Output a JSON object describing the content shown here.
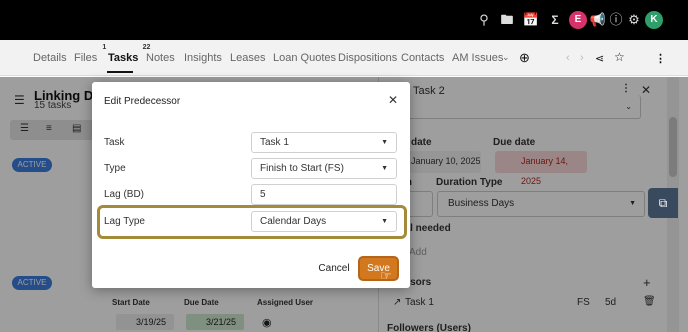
{
  "topbar": {
    "icons": [
      "search-icon",
      "folder-icon",
      "calendar-icon",
      "sigma-icon",
      "megaphone-icon",
      "help-icon",
      "gear-icon"
    ],
    "avatar_e": "E",
    "avatar_k": "K",
    "colors": {
      "avatar_e": "#d6336c",
      "avatar_k": "#2f9e6a"
    }
  },
  "tabs": [
    {
      "label": "Details"
    },
    {
      "label": "Files",
      "badge": "1"
    },
    {
      "label": "Tasks",
      "badge": "22",
      "active": true
    },
    {
      "label": "Notes"
    },
    {
      "label": "Insights"
    },
    {
      "label": "Leases"
    },
    {
      "label": "Loan Quotes"
    },
    {
      "label": "Dispositions"
    },
    {
      "label": "Contacts"
    },
    {
      "label": "AM Issues"
    }
  ],
  "left": {
    "title": "Linking Dea",
    "subtitle": "15 tasks",
    "status_pill": "ACTIVE",
    "grid_headers": {
      "start": "Start Date",
      "due": "Due Date",
      "user": "Assigned User"
    },
    "row": {
      "start": "3/19/25",
      "due": "3/21/25"
    }
  },
  "right": {
    "title": "Task 2",
    "start_label": "date",
    "start_value": "January 10, 2025",
    "due_label": "Due date",
    "due_value": "January 14, 2025",
    "duration_label": "ion",
    "duration_type_label": "Duration Type",
    "duration_type_value": "Business Days",
    "approval_label": "val needed",
    "add_label": "Add",
    "predecessors_label": "essors",
    "pred_task": "Task 1",
    "pred_type": "FS",
    "pred_lag": "5d",
    "followers_label": "Followers (Users)"
  },
  "modal": {
    "title": "Edit Predecessor",
    "fields": [
      {
        "label": "Task",
        "value": "Task 1",
        "dropdown": true
      },
      {
        "label": "Type",
        "value": "Finish to Start (FS)",
        "dropdown": true
      },
      {
        "label": "Lag (BD)",
        "value": "5",
        "dropdown": false
      },
      {
        "label": "Lag Type",
        "value": "Calendar Days",
        "dropdown": true
      }
    ],
    "cancel_label": "Cancel",
    "save_label": "Save",
    "colors": {
      "save": "#d2781f",
      "highlight": "#a48b3a"
    }
  }
}
